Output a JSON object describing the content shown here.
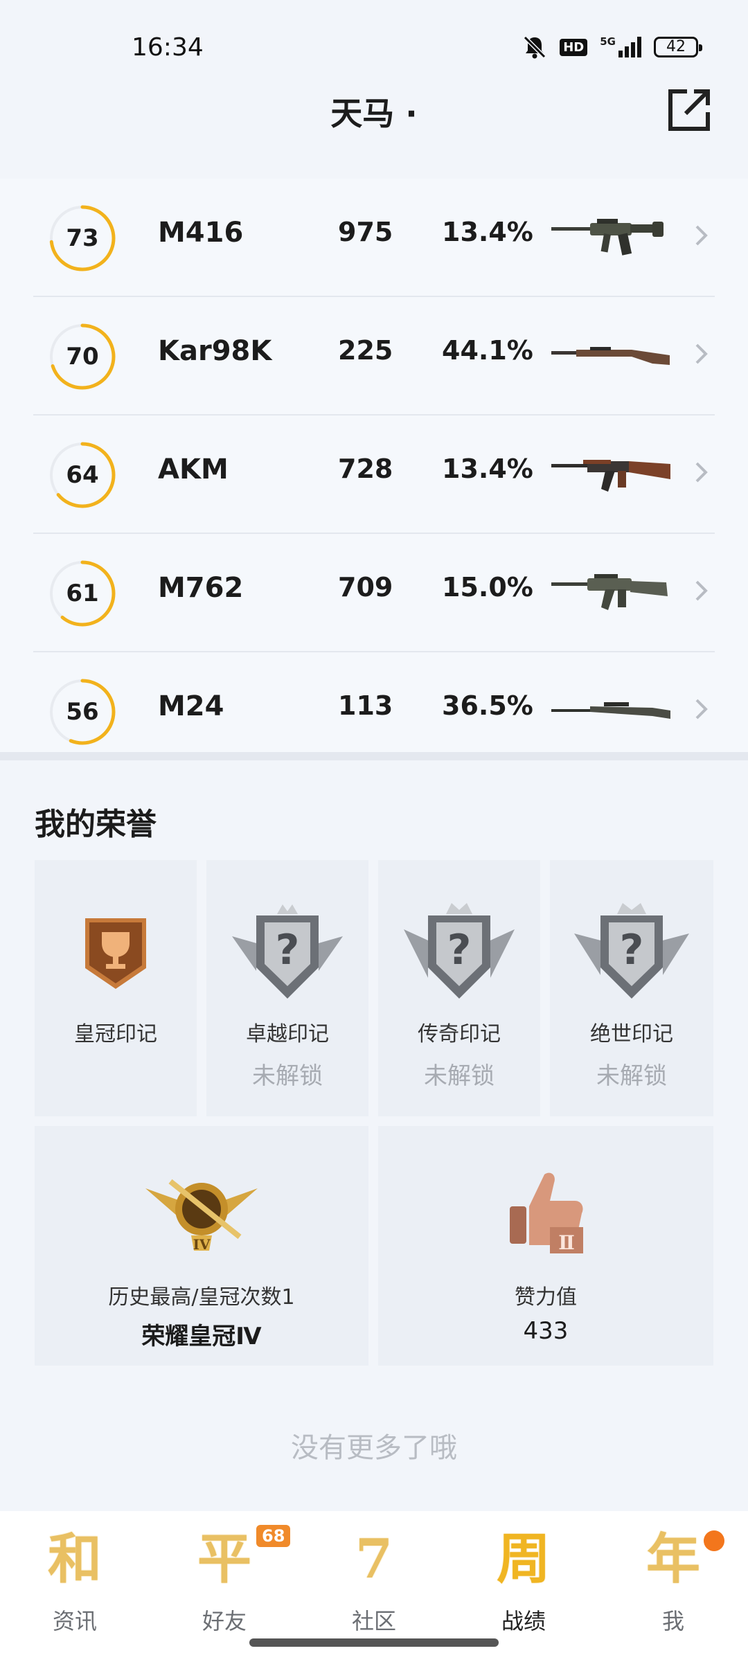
{
  "status_bar": {
    "time": "16:34",
    "network": "5G",
    "hd": "HD",
    "battery": "42",
    "icons": [
      "bell-off-icon",
      "hd-icon",
      "signal-icon",
      "battery-icon"
    ]
  },
  "header": {
    "title": "天马 ·",
    "share_icon": "share-external-icon"
  },
  "weapons": [
    {
      "score": "73",
      "score_value": 73,
      "name": "M416",
      "count": "975",
      "pct": "13.4%",
      "image": "m416-rifle"
    },
    {
      "score": "70",
      "score_value": 70,
      "name": "Kar98K",
      "count": "225",
      "pct": "44.1%",
      "image": "kar98k-rifle"
    },
    {
      "score": "64",
      "score_value": 64,
      "name": "AKM",
      "count": "728",
      "pct": "13.4%",
      "image": "akm-rifle"
    },
    {
      "score": "61",
      "score_value": 61,
      "name": "M762",
      "count": "709",
      "pct": "15.0%",
      "image": "m762-rifle"
    },
    {
      "score": "56",
      "score_value": 56,
      "name": "M24",
      "count": "113",
      "pct": "36.5%",
      "image": "m24-rifle"
    }
  ],
  "honors": {
    "title": "我的荣誉",
    "marks": [
      {
        "label": "皇冠印记",
        "status": "",
        "icon": "crown-trophy-badge-icon"
      },
      {
        "label": "卓越印记",
        "status": "未解锁",
        "icon": "locked-badge-icon"
      },
      {
        "label": "传奇印记",
        "status": "未解锁",
        "icon": "locked-badge-icon"
      },
      {
        "label": "绝世印记",
        "status": "未解锁",
        "icon": "locked-badge-icon"
      }
    ],
    "highest": {
      "label": "历史最高/皇冠次数1",
      "value": "荣耀皇冠Ⅳ",
      "tier": "IV",
      "icon": "crown-rank-emblem-icon"
    },
    "likes": {
      "label": "赞力值",
      "value": "433",
      "icon": "thumbs-up-icon",
      "tier": "Ⅱ"
    }
  },
  "footer_note": "没有更多了哦",
  "bottom_nav": [
    {
      "glyph": "和",
      "label": "资讯",
      "active": false
    },
    {
      "glyph": "平",
      "label": "好友",
      "badge": "68",
      "active": false
    },
    {
      "glyph": "7",
      "label": "社区",
      "active": false
    },
    {
      "glyph": "周",
      "label": "战绩",
      "active": true
    },
    {
      "glyph": "年",
      "label": "我",
      "dot": true,
      "active": false
    }
  ],
  "colors": {
    "ring_accent": "#f2b21c",
    "ring_track": "#e8ebf0",
    "background": "#f2f5fa"
  }
}
